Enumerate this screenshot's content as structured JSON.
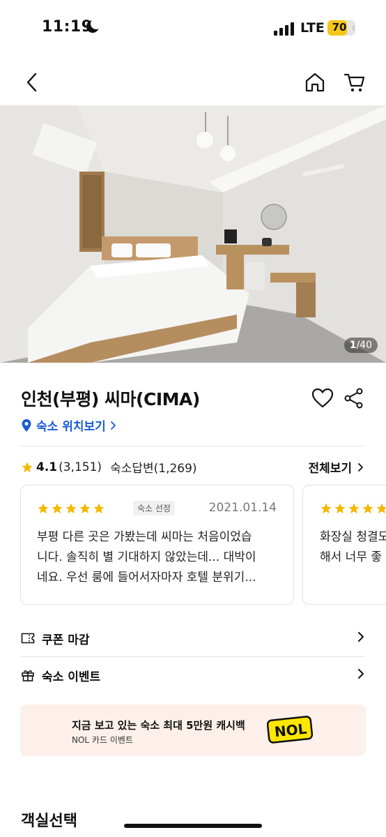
{
  "status_bar": {
    "time": "11:19",
    "network": "LTE",
    "battery": "70",
    "battery_level": 0.7
  },
  "hero": {
    "photo_index": "1",
    "photo_total": "/40"
  },
  "property": {
    "name": "인천(부평) 씨마(CIMA)",
    "location_link": "숙소 위치보기"
  },
  "rating": {
    "score": "4.1",
    "count": "(3,151)",
    "host_replies": "숙소답변(1,269)",
    "see_all": "전체보기"
  },
  "reviews": [
    {
      "stars": 5,
      "badge": "숙소 선정",
      "date": "2021.01.14",
      "lines": [
        "부평 다른 곳은 가봤는데 씨마는 처음이었습",
        "니다. 솔직히 별 기대하지 않았는데... 대박이",
        "네요. 우선 룸에 들어서자마자 호텔 분위기..."
      ]
    },
    {
      "stars": 5,
      "lines": [
        "화장실 청결도",
        "해서 너무 좋"
      ]
    }
  ],
  "info_rows": {
    "coupon": "쿠폰 마감",
    "event": "숙소 이벤트"
  },
  "banner": {
    "title": "지금 보고 있는 숙소 최대 5만원 캐시백",
    "subtitle": "NOL 카드 이벤트",
    "logo_text": "NOL"
  },
  "room_section": {
    "title": "객실선택"
  },
  "colors": {
    "accent_blue": "#1a5bd6",
    "star": "#f5b800",
    "battery": "#f5c518",
    "banner_bg": "#fdf0ea"
  }
}
